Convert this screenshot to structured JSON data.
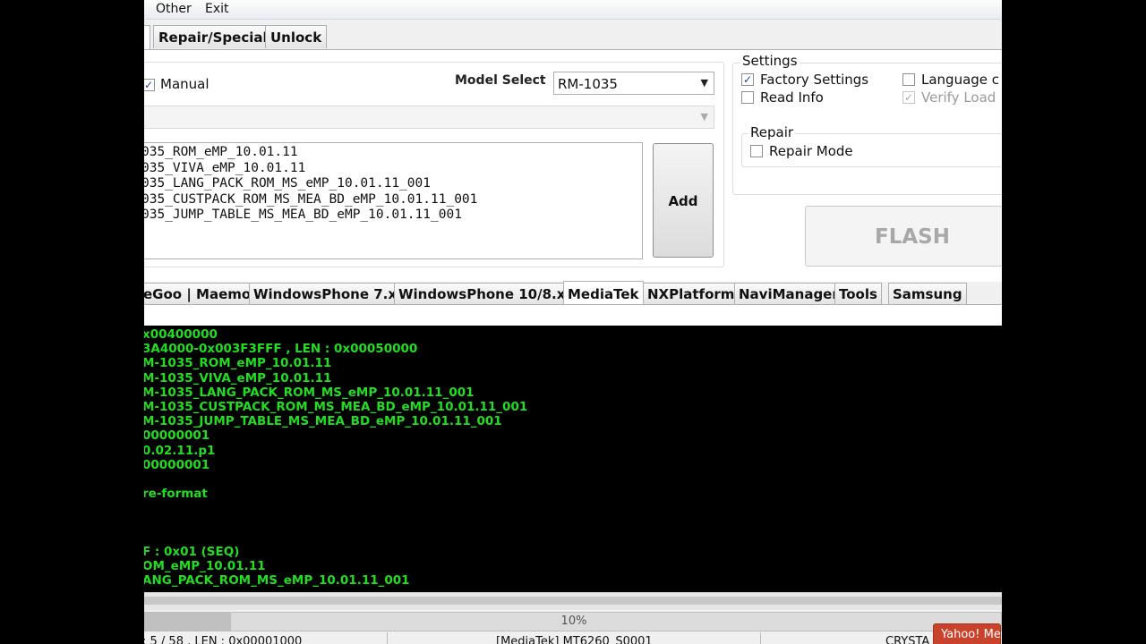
{
  "menu": {
    "items": [
      "Other",
      "Exit"
    ]
  },
  "top_tabs": [
    {
      "label": "Repair/Special"
    },
    {
      "label": "Unlock"
    }
  ],
  "manual": {
    "label": "Manual",
    "checked": true
  },
  "model_select": {
    "label": "Model Select",
    "value": "RM-1035"
  },
  "files": [
    "035_ROM_eMP_10.01.11",
    "035_VIVA_eMP_10.01.11",
    "035_LANG_PACK_ROM_MS_eMP_10.01.11_001",
    "035_CUSTPACK_ROM_MS_MEA_BD_eMP_10.01.11_001",
    "035_JUMP_TABLE_MS_MEA_BD_eMP_10.01.11_001"
  ],
  "add_button": "Add",
  "settings": {
    "title": "Settings",
    "factory": {
      "label": "Factory Settings",
      "checked": true
    },
    "language": {
      "label": "Language c",
      "checked": false
    },
    "read_info": {
      "label": "Read Info",
      "checked": false
    },
    "verify_load": {
      "label": "Verify Load",
      "checked": true,
      "disabled": true
    }
  },
  "repair": {
    "title": "Repair",
    "repair_mode": {
      "label": "Repair Mode",
      "checked": false
    }
  },
  "flash_button": "FLASH",
  "bottom_tabs": [
    {
      "label": "eGoo | Maemo"
    },
    {
      "label": "WindowsPhone 7.x"
    },
    {
      "label": "WindowsPhone 10/8.x"
    },
    {
      "label": "MediaTek"
    },
    {
      "label": "NXPlatform"
    },
    {
      "label": "NaviManager"
    },
    {
      "label": "Tools"
    },
    {
      "label": "Samsung"
    }
  ],
  "log_lines": [
    "x00400000",
    "3A4000-0x003F3FFF , LEN : 0x00050000",
    "M-1035_ROM_eMP_10.01.11",
    "M-1035_VIVA_eMP_10.01.11",
    "M-1035_LANG_PACK_ROM_MS_eMP_10.01.11_001",
    "M-1035_CUSTPACK_ROM_MS_MEA_BD_eMP_10.01.11_001",
    "M-1035_JUMP_TABLE_MS_MEA_BD_eMP_10.01.11_001",
    "00000001",
    "0.02.11.p1",
    "00000001",
    "",
    "re-format",
    "",
    "",
    "",
    "F : 0x01 (SEQ)",
    "OM_eMP_10.01.11",
    "ANG_PACK_ROM_MS_eMP_10.01.11_001"
  ],
  "progress": {
    "text": "10%",
    "value": 0.1
  },
  "status": {
    "left": ": 5 / 58 , LEN : 0x00001000",
    "center": "[MediaTek] MT6260_S0001",
    "right": "CRYSTA"
  },
  "yahoo": "Yahoo! Mes"
}
